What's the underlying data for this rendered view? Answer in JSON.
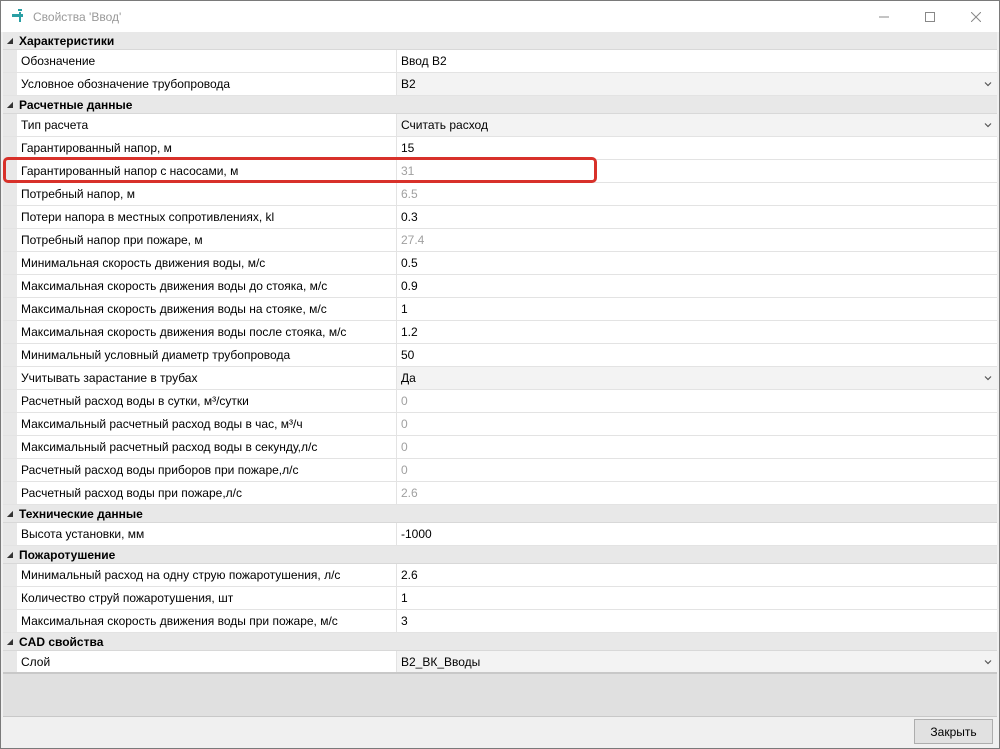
{
  "window": {
    "title": "Свойства 'Ввод'",
    "icon": "faucet-icon"
  },
  "sections": [
    {
      "label": "Характеристики",
      "rows": [
        {
          "name": "Обозначение",
          "value": "Ввод В2",
          "readonly": false,
          "dropdown": false
        },
        {
          "name": "Условное обозначение трубопровода",
          "value": "В2",
          "readonly": false,
          "dropdown": true
        }
      ]
    },
    {
      "label": "Расчетные данные",
      "rows": [
        {
          "name": "Тип расчета",
          "value": "Считать расход",
          "readonly": false,
          "dropdown": true
        },
        {
          "name": "Гарантированный напор, м",
          "value": "15",
          "readonly": false,
          "dropdown": false
        },
        {
          "name": "Гарантированный напор с насосами, м",
          "value": "31",
          "readonly": true,
          "dropdown": false
        },
        {
          "name": "Потребный напор, м",
          "value": "6.5",
          "readonly": true,
          "dropdown": false
        },
        {
          "name": "Потери напора в местных сопротивлениях, kl",
          "value": "0.3",
          "readonly": false,
          "dropdown": false
        },
        {
          "name": "Потребный напор при пожаре, м",
          "value": "27.4",
          "readonly": true,
          "dropdown": false
        },
        {
          "name": "Минимальная скорость движения воды, м/с",
          "value": "0.5",
          "readonly": false,
          "dropdown": false
        },
        {
          "name": "Максимальная скорость движения воды до стояка, м/с",
          "value": "0.9",
          "readonly": false,
          "dropdown": false
        },
        {
          "name": "Максимальная скорость движения воды на стояке, м/с",
          "value": "1",
          "readonly": false,
          "dropdown": false
        },
        {
          "name": "Максимальная скорость движения воды после стояка, м/с",
          "value": "1.2",
          "readonly": false,
          "dropdown": false
        },
        {
          "name": "Минимальный условный диаметр трубопровода",
          "value": "50",
          "readonly": false,
          "dropdown": false
        },
        {
          "name": "Учитывать зарастание в трубах",
          "value": "Да",
          "readonly": false,
          "dropdown": true
        },
        {
          "name": "Расчетный расход воды в сутки, м³/сутки",
          "value": "0",
          "readonly": true,
          "dropdown": false
        },
        {
          "name": "Максимальный расчетный расход воды в час, м³/ч",
          "value": "0",
          "readonly": true,
          "dropdown": false
        },
        {
          "name": "Максимальный расчетный расход воды в секунду,л/с",
          "value": "0",
          "readonly": true,
          "dropdown": false
        },
        {
          "name": "Расчетный расход воды приборов при пожаре,л/с",
          "value": "0",
          "readonly": true,
          "dropdown": false
        },
        {
          "name": "Расчетный расход воды при пожаре,л/с",
          "value": "2.6",
          "readonly": true,
          "dropdown": false
        }
      ]
    },
    {
      "label": "Технические данные",
      "rows": [
        {
          "name": "Высота установки, мм",
          "value": "-1000",
          "readonly": false,
          "dropdown": false
        }
      ]
    },
    {
      "label": "Пожаротушение",
      "rows": [
        {
          "name": "Минимальный расход на одну струю пожаротушения, л/с",
          "value": "2.6",
          "readonly": false,
          "dropdown": false
        },
        {
          "name": "Количество струй пожаротушения, шт",
          "value": "1",
          "readonly": false,
          "dropdown": false
        },
        {
          "name": "Максимальная скорость движения воды при пожаре, м/с",
          "value": "3",
          "readonly": false,
          "dropdown": false
        }
      ]
    },
    {
      "label": "CAD свойства",
      "rows": [
        {
          "name": "Слой",
          "value": "В2_ВК_Вводы",
          "readonly": false,
          "dropdown": true
        }
      ]
    }
  ],
  "footer": {
    "close_label": "Закрыть"
  },
  "colors": {
    "highlight": "#d8312a",
    "readonly_text": "#a0a0a0",
    "category_bg": "#e8e8e8"
  }
}
